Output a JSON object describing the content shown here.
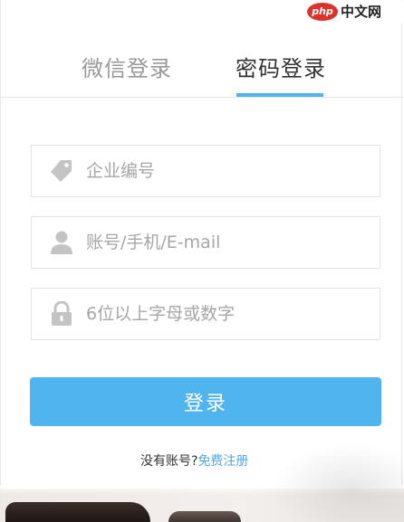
{
  "tabs": [
    {
      "label": "微信登录",
      "active": false
    },
    {
      "label": "密码登录",
      "active": true
    }
  ],
  "fields": {
    "company": {
      "placeholder": "企业编号",
      "value": "",
      "icon": "tag-icon"
    },
    "account": {
      "placeholder": "账号/手机/E-mail",
      "value": "",
      "icon": "user-icon"
    },
    "password": {
      "placeholder": "6位以上字母或数字",
      "value": "",
      "icon": "lock-icon"
    }
  },
  "login_button": {
    "label": "登录"
  },
  "register": {
    "prompt": "没有账号?",
    "link": "免费注册"
  },
  "watermark": {
    "logo": "php",
    "text": "中文网"
  },
  "colors": {
    "accent": "#50b4ef",
    "link": "#4fa8e0",
    "tab_active_text": "#333333",
    "tab_inactive_text": "#999999"
  }
}
